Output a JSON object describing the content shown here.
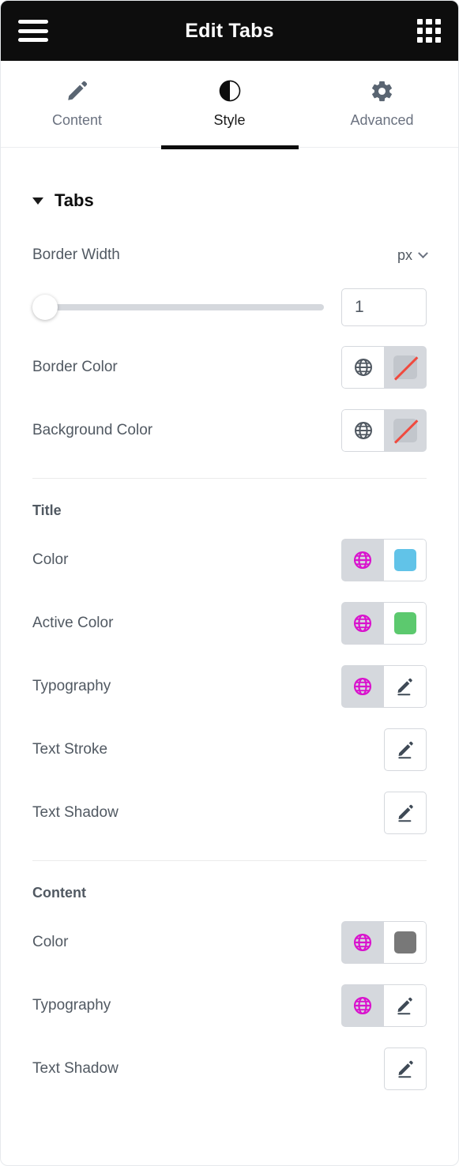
{
  "header": {
    "title": "Edit Tabs",
    "menu_icon": "hamburger-icon",
    "apps_icon": "grid-apps-icon"
  },
  "tabs": [
    {
      "label": "Content",
      "icon": "pencil-icon",
      "active": false
    },
    {
      "label": "Style",
      "icon": "contrast-icon",
      "active": true
    },
    {
      "label": "Advanced",
      "icon": "gear-icon",
      "active": false
    }
  ],
  "sections": [
    {
      "title": "Tabs",
      "expanded": true,
      "controls": [
        {
          "label": "Border Width",
          "type": "slider",
          "unit": "px",
          "value": "1",
          "slider_percent": 0
        },
        {
          "label": "Border Color",
          "type": "color",
          "globe_active": false,
          "swatch": "transparent"
        },
        {
          "label": "Background Color",
          "type": "color",
          "globe_active": false,
          "swatch": "transparent"
        }
      ]
    },
    {
      "subhead": "Title",
      "controls": [
        {
          "label": "Color",
          "type": "color",
          "globe_active": true,
          "swatch": "#61c3e8"
        },
        {
          "label": "Active Color",
          "type": "color",
          "globe_active": true,
          "swatch": "#5cc96e"
        },
        {
          "label": "Typography",
          "type": "pencil",
          "globe_active": true
        },
        {
          "label": "Text Stroke",
          "type": "pencil-only"
        },
        {
          "label": "Text Shadow",
          "type": "pencil-only"
        }
      ]
    },
    {
      "subhead": "Content",
      "controls": [
        {
          "label": "Color",
          "type": "color",
          "globe_active": true,
          "swatch": "#787878"
        },
        {
          "label": "Typography",
          "type": "pencil",
          "globe_active": true
        },
        {
          "label": "Text Shadow",
          "type": "pencil-only"
        }
      ]
    }
  ],
  "colors": {
    "header_bg": "#0d0d0d",
    "accent_globe_active": "#d913cd",
    "globe_inactive": "#515962",
    "label": "#515962",
    "divider": "#ebebeb",
    "control_bg_active": "#d5d8dd",
    "transparent_slash": "#f04a3f"
  }
}
